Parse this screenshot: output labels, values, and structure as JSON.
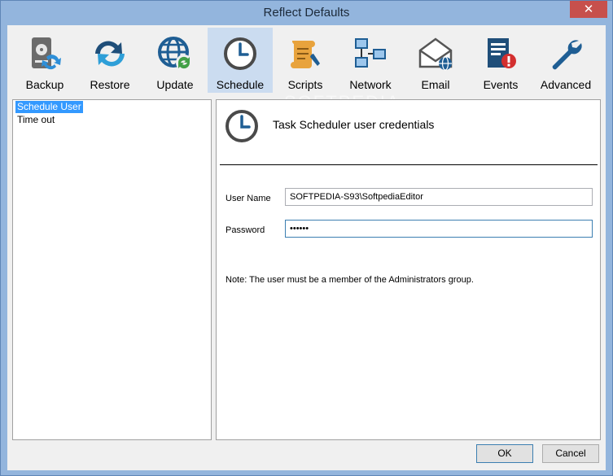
{
  "window": {
    "title": "Reflect Defaults",
    "close_glyph": "✕"
  },
  "watermark": "SOFTPEDIA",
  "toolbar": [
    {
      "id": "backup",
      "label": "Backup",
      "icon": "backup-drive-icon"
    },
    {
      "id": "restore",
      "label": "Restore",
      "icon": "restore-arrows-icon"
    },
    {
      "id": "update",
      "label": "Update",
      "icon": "update-globe-icon"
    },
    {
      "id": "schedule",
      "label": "Schedule",
      "icon": "clock-icon",
      "selected": true
    },
    {
      "id": "scripts",
      "label": "Scripts",
      "icon": "scripts-scroll-icon"
    },
    {
      "id": "network",
      "label": "Network",
      "icon": "network-icon"
    },
    {
      "id": "email",
      "label": "Email",
      "icon": "email-icon"
    },
    {
      "id": "events",
      "label": "Events",
      "icon": "events-log-icon"
    },
    {
      "id": "advanced",
      "label": "Advanced",
      "icon": "wrench-icon"
    }
  ],
  "tree": [
    {
      "label": "Schedule User",
      "selected": true
    },
    {
      "label": "Time out"
    }
  ],
  "panel": {
    "heading": "Task Scheduler user credentials",
    "user_label": "User Name",
    "user_value": "SOFTPEDIA-S93\\SoftpediaEditor",
    "password_label": "Password",
    "password_value": "••••••",
    "note": "Note: The user must be a member of the Administrators group."
  },
  "buttons": {
    "ok": "OK",
    "cancel": "Cancel"
  },
  "colors": {
    "titlebar": "#93b5dd",
    "selection": "#3399ff",
    "tool_selected": "#cbdcf0",
    "close": "#c7504c"
  }
}
